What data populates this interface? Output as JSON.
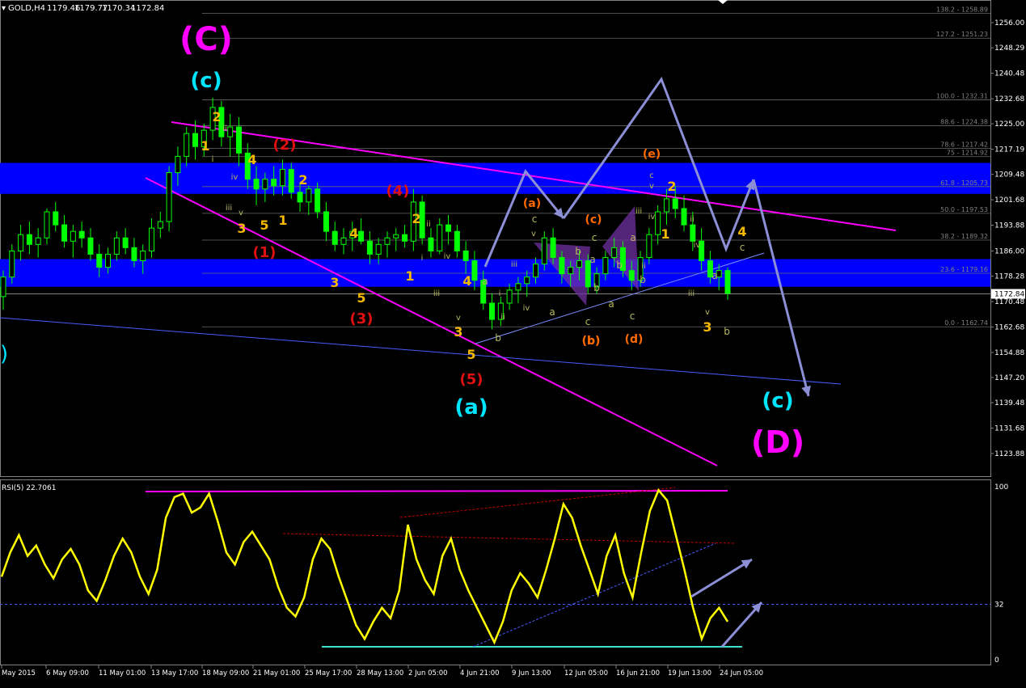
{
  "header": {
    "symbol": "GOLD,H4",
    "open": "1179.46",
    "high": "1179.77",
    "low": "1170.34",
    "close": "1172.84"
  },
  "colors": {
    "background": "#000000",
    "candle": "#00ff00",
    "zone": "#0000ff",
    "magenta": "#ff00ff",
    "cyan": "#00e5ff",
    "yellow_label": "#f5b800",
    "red_label": "#e01010",
    "orange_label": "#ff6a00",
    "projection": "#8c8fd6",
    "rsi_line": "#ffff00",
    "fib_text": "#808080"
  },
  "chart_data": {
    "type": "candlestick",
    "price_axis": {
      "ylim": [
        1120,
        1262
      ],
      "ticks": [
        "1256.00",
        "1248.29",
        "1240.48",
        "1232.68",
        "1225.00",
        "1217.19",
        "1209.48",
        "1201.68",
        "1193.88",
        "1186.00",
        "1178.28",
        "1170.48",
        "1162.68",
        "1154.88",
        "1147.20",
        "1139.48",
        "1131.68",
        "1123.88"
      ],
      "current_price": "1172.84"
    },
    "time_axis": {
      "ticks": [
        "May 2015",
        "6 May 09:00",
        "11 May 01:00",
        "13 May 17:00",
        "18 May 09:00",
        "21 May 01:00",
        "25 May 17:00",
        "28 May 13:00",
        "2 Jun 05:00",
        "4 Jun 21:00",
        "9 Jun 13:00",
        "12 Jun 05:00",
        "16 Jun 21:00",
        "19 Jun 13:00",
        "24 Jun 05:00"
      ]
    },
    "fib_levels": [
      {
        "label": "138.2 - 1258.89",
        "price": 1258.89
      },
      {
        "label": "127.2 - 1251.23",
        "price": 1251.23
      },
      {
        "label": "100.0 - 1232.31",
        "price": 1232.31
      },
      {
        "label": "88.6 - 1224.38",
        "price": 1224.38
      },
      {
        "label": "78.6 - 1217.42",
        "price": 1217.42
      },
      {
        "label": "75 - 1214.92",
        "price": 1214.92
      },
      {
        "label": "61.8 - 1205.73",
        "price": 1205.73
      },
      {
        "label": "50.0 - 1197.53",
        "price": 1197.53
      },
      {
        "label": "38.2 - 1189.32",
        "price": 1189.32
      },
      {
        "label": "23.6 - 1179.16",
        "price": 1179.16
      },
      {
        "label": "0.0 - 1162.74",
        "price": 1162.74
      }
    ],
    "zones": [
      {
        "from": 1203.5,
        "to": 1213.0
      },
      {
        "from": 1175.0,
        "to": 1183.5
      }
    ],
    "candles": [
      [
        1172,
        1180,
        1168,
        1178
      ],
      [
        1178,
        1188,
        1176,
        1186
      ],
      [
        1186,
        1194,
        1183,
        1191
      ],
      [
        1191,
        1195,
        1185,
        1188
      ],
      [
        1188,
        1193,
        1184,
        1190
      ],
      [
        1190,
        1199,
        1188,
        1198
      ],
      [
        1198,
        1201,
        1192,
        1194
      ],
      [
        1194,
        1197,
        1187,
        1189
      ],
      [
        1189,
        1194,
        1184,
        1192
      ],
      [
        1192,
        1195,
        1187,
        1190
      ],
      [
        1190,
        1193,
        1183,
        1185
      ],
      [
        1185,
        1188,
        1178,
        1181
      ],
      [
        1181,
        1187,
        1179,
        1185
      ],
      [
        1185,
        1192,
        1183,
        1190
      ],
      [
        1190,
        1193,
        1185,
        1187
      ],
      [
        1187,
        1190,
        1181,
        1183
      ],
      [
        1183,
        1188,
        1179,
        1186
      ],
      [
        1186,
        1196,
        1184,
        1193
      ],
      [
        1193,
        1198,
        1190,
        1195
      ],
      [
        1195,
        1212,
        1192,
        1210
      ],
      [
        1210,
        1218,
        1206,
        1215
      ],
      [
        1215,
        1224,
        1212,
        1222
      ],
      [
        1222,
        1226,
        1214,
        1218
      ],
      [
        1218,
        1225,
        1215,
        1223
      ],
      [
        1223,
        1233,
        1220,
        1230
      ],
      [
        1230,
        1232,
        1218,
        1221
      ],
      [
        1221,
        1228,
        1215,
        1224
      ],
      [
        1224,
        1227,
        1212,
        1216
      ],
      [
        1216,
        1219,
        1205,
        1208
      ],
      [
        1208,
        1212,
        1200,
        1205
      ],
      [
        1205,
        1210,
        1201,
        1208
      ],
      [
        1208,
        1212,
        1203,
        1206
      ],
      [
        1206,
        1214,
        1203,
        1211
      ],
      [
        1211,
        1213,
        1202,
        1204
      ],
      [
        1204,
        1207,
        1198,
        1201
      ],
      [
        1201,
        1206,
        1197,
        1205
      ],
      [
        1205,
        1207,
        1196,
        1198
      ],
      [
        1198,
        1201,
        1189,
        1192
      ],
      [
        1192,
        1195,
        1186,
        1188
      ],
      [
        1188,
        1193,
        1185,
        1190
      ],
      [
        1190,
        1195,
        1186,
        1192
      ],
      [
        1192,
        1196,
        1188,
        1189
      ],
      [
        1189,
        1192,
        1182,
        1185
      ],
      [
        1185,
        1190,
        1182,
        1188
      ],
      [
        1188,
        1192,
        1184,
        1190
      ],
      [
        1190,
        1193,
        1186,
        1191
      ],
      [
        1191,
        1194,
        1187,
        1189
      ],
      [
        1189,
        1205,
        1186,
        1201
      ],
      [
        1201,
        1203,
        1188,
        1190
      ],
      [
        1190,
        1193,
        1184,
        1186
      ],
      [
        1186,
        1196,
        1185,
        1194
      ],
      [
        1194,
        1197,
        1188,
        1192
      ],
      [
        1192,
        1194,
        1184,
        1186
      ],
      [
        1186,
        1189,
        1179,
        1183
      ],
      [
        1183,
        1186,
        1174,
        1177
      ],
      [
        1177,
        1180,
        1168,
        1170
      ],
      [
        1170,
        1173,
        1162,
        1165
      ],
      [
        1165,
        1172,
        1163,
        1170
      ],
      [
        1170,
        1176,
        1168,
        1174
      ],
      [
        1174,
        1178,
        1170,
        1176
      ],
      [
        1176,
        1180,
        1172,
        1178
      ],
      [
        1178,
        1184,
        1176,
        1182
      ],
      [
        1182,
        1192,
        1180,
        1190
      ],
      [
        1190,
        1193,
        1182,
        1184
      ],
      [
        1184,
        1186,
        1176,
        1179
      ],
      [
        1179,
        1183,
        1175,
        1181
      ],
      [
        1181,
        1186,
        1177,
        1183
      ],
      [
        1183,
        1185,
        1173,
        1175
      ],
      [
        1175,
        1181,
        1173,
        1179
      ],
      [
        1179,
        1186,
        1177,
        1184
      ],
      [
        1184,
        1190,
        1181,
        1187
      ],
      [
        1187,
        1189,
        1178,
        1180
      ],
      [
        1180,
        1183,
        1174,
        1177
      ],
      [
        1177,
        1186,
        1175,
        1184
      ],
      [
        1184,
        1193,
        1182,
        1191
      ],
      [
        1191,
        1200,
        1188,
        1198
      ],
      [
        1198,
        1205,
        1194,
        1202
      ],
      [
        1202,
        1206,
        1196,
        1199
      ],
      [
        1199,
        1203,
        1192,
        1194
      ],
      [
        1194,
        1198,
        1186,
        1189
      ],
      [
        1189,
        1193,
        1180,
        1183
      ],
      [
        1183,
        1186,
        1176,
        1178
      ],
      [
        1178,
        1182,
        1174,
        1180
      ],
      [
        1180,
        1181,
        1171,
        1173
      ]
    ],
    "rsi": {
      "label": "RSI(5) 22.7061",
      "ylim": [
        0,
        100
      ],
      "ticks": [
        "100",
        "32",
        "0"
      ],
      "level": 32,
      "values": [
        48,
        62,
        72,
        60,
        66,
        55,
        47,
        58,
        64,
        55,
        40,
        34,
        46,
        60,
        70,
        62,
        48,
        38,
        52,
        82,
        94,
        96,
        85,
        88,
        96,
        80,
        62,
        55,
        68,
        74,
        66,
        58,
        42,
        30,
        25,
        36,
        58,
        70,
        64,
        48,
        34,
        20,
        12,
        22,
        30,
        24,
        40,
        78,
        58,
        46,
        38,
        60,
        70,
        52,
        40,
        30,
        20,
        10,
        22,
        40,
        50,
        44,
        36,
        52,
        70,
        90,
        82,
        66,
        52,
        38,
        60,
        72,
        50,
        36,
        62,
        86,
        98,
        92,
        72,
        52,
        30,
        12,
        24,
        30,
        22
      ]
    },
    "wave_labels": [
      "(C)",
      "(c)",
      "(2)",
      "(1)",
      "(4)",
      "(3)",
      "(5)",
      "(a)",
      "(b)",
      "(a)",
      "(c)",
      "(b)",
      "(d)",
      "(e)",
      "(c)",
      "(D)",
      "1",
      "2",
      "3",
      "4",
      "5",
      "i",
      "ii",
      "iii",
      "iv",
      "v",
      "a",
      "b",
      "c"
    ]
  }
}
